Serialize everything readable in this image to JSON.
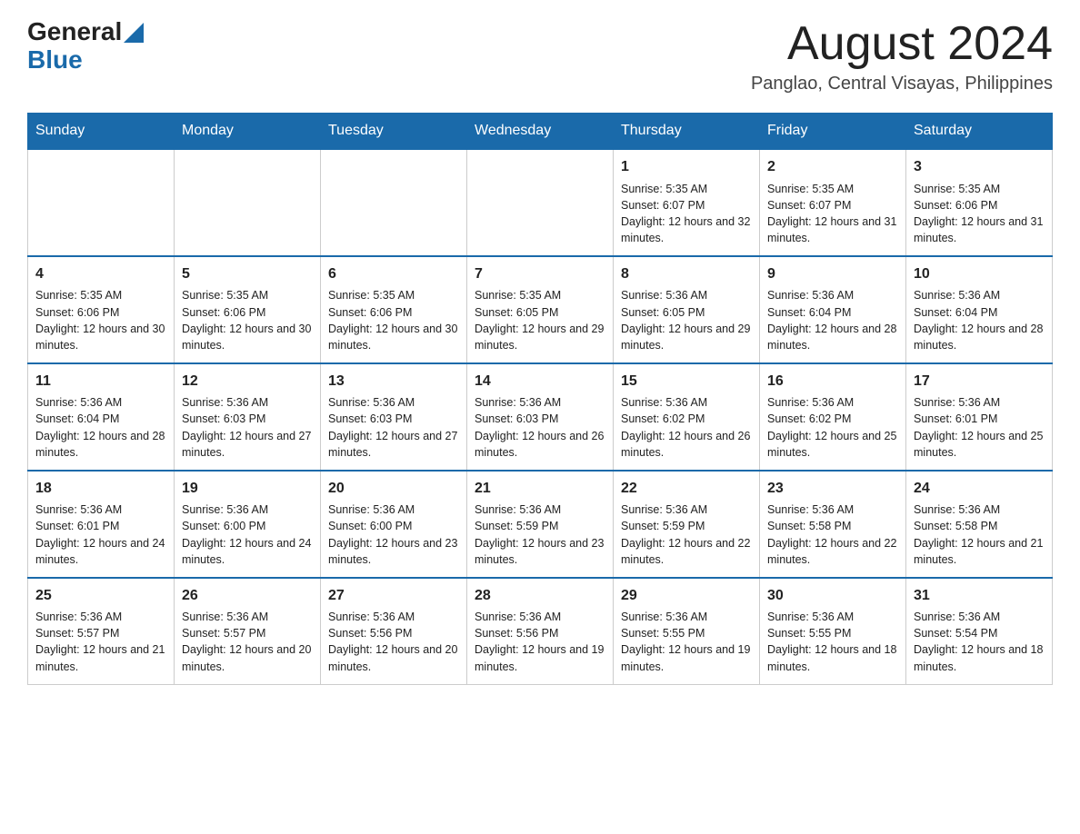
{
  "header": {
    "logo_general": "General",
    "logo_blue": "Blue",
    "month_title": "August 2024",
    "location": "Panglao, Central Visayas, Philippines"
  },
  "days_of_week": [
    "Sunday",
    "Monday",
    "Tuesday",
    "Wednesday",
    "Thursday",
    "Friday",
    "Saturday"
  ],
  "weeks": [
    [
      {
        "day": "",
        "info": ""
      },
      {
        "day": "",
        "info": ""
      },
      {
        "day": "",
        "info": ""
      },
      {
        "day": "",
        "info": ""
      },
      {
        "day": "1",
        "info": "Sunrise: 5:35 AM\nSunset: 6:07 PM\nDaylight: 12 hours and 32 minutes."
      },
      {
        "day": "2",
        "info": "Sunrise: 5:35 AM\nSunset: 6:07 PM\nDaylight: 12 hours and 31 minutes."
      },
      {
        "day": "3",
        "info": "Sunrise: 5:35 AM\nSunset: 6:06 PM\nDaylight: 12 hours and 31 minutes."
      }
    ],
    [
      {
        "day": "4",
        "info": "Sunrise: 5:35 AM\nSunset: 6:06 PM\nDaylight: 12 hours and 30 minutes."
      },
      {
        "day": "5",
        "info": "Sunrise: 5:35 AM\nSunset: 6:06 PM\nDaylight: 12 hours and 30 minutes."
      },
      {
        "day": "6",
        "info": "Sunrise: 5:35 AM\nSunset: 6:06 PM\nDaylight: 12 hours and 30 minutes."
      },
      {
        "day": "7",
        "info": "Sunrise: 5:35 AM\nSunset: 6:05 PM\nDaylight: 12 hours and 29 minutes."
      },
      {
        "day": "8",
        "info": "Sunrise: 5:36 AM\nSunset: 6:05 PM\nDaylight: 12 hours and 29 minutes."
      },
      {
        "day": "9",
        "info": "Sunrise: 5:36 AM\nSunset: 6:04 PM\nDaylight: 12 hours and 28 minutes."
      },
      {
        "day": "10",
        "info": "Sunrise: 5:36 AM\nSunset: 6:04 PM\nDaylight: 12 hours and 28 minutes."
      }
    ],
    [
      {
        "day": "11",
        "info": "Sunrise: 5:36 AM\nSunset: 6:04 PM\nDaylight: 12 hours and 28 minutes."
      },
      {
        "day": "12",
        "info": "Sunrise: 5:36 AM\nSunset: 6:03 PM\nDaylight: 12 hours and 27 minutes."
      },
      {
        "day": "13",
        "info": "Sunrise: 5:36 AM\nSunset: 6:03 PM\nDaylight: 12 hours and 27 minutes."
      },
      {
        "day": "14",
        "info": "Sunrise: 5:36 AM\nSunset: 6:03 PM\nDaylight: 12 hours and 26 minutes."
      },
      {
        "day": "15",
        "info": "Sunrise: 5:36 AM\nSunset: 6:02 PM\nDaylight: 12 hours and 26 minutes."
      },
      {
        "day": "16",
        "info": "Sunrise: 5:36 AM\nSunset: 6:02 PM\nDaylight: 12 hours and 25 minutes."
      },
      {
        "day": "17",
        "info": "Sunrise: 5:36 AM\nSunset: 6:01 PM\nDaylight: 12 hours and 25 minutes."
      }
    ],
    [
      {
        "day": "18",
        "info": "Sunrise: 5:36 AM\nSunset: 6:01 PM\nDaylight: 12 hours and 24 minutes."
      },
      {
        "day": "19",
        "info": "Sunrise: 5:36 AM\nSunset: 6:00 PM\nDaylight: 12 hours and 24 minutes."
      },
      {
        "day": "20",
        "info": "Sunrise: 5:36 AM\nSunset: 6:00 PM\nDaylight: 12 hours and 23 minutes."
      },
      {
        "day": "21",
        "info": "Sunrise: 5:36 AM\nSunset: 5:59 PM\nDaylight: 12 hours and 23 minutes."
      },
      {
        "day": "22",
        "info": "Sunrise: 5:36 AM\nSunset: 5:59 PM\nDaylight: 12 hours and 22 minutes."
      },
      {
        "day": "23",
        "info": "Sunrise: 5:36 AM\nSunset: 5:58 PM\nDaylight: 12 hours and 22 minutes."
      },
      {
        "day": "24",
        "info": "Sunrise: 5:36 AM\nSunset: 5:58 PM\nDaylight: 12 hours and 21 minutes."
      }
    ],
    [
      {
        "day": "25",
        "info": "Sunrise: 5:36 AM\nSunset: 5:57 PM\nDaylight: 12 hours and 21 minutes."
      },
      {
        "day": "26",
        "info": "Sunrise: 5:36 AM\nSunset: 5:57 PM\nDaylight: 12 hours and 20 minutes."
      },
      {
        "day": "27",
        "info": "Sunrise: 5:36 AM\nSunset: 5:56 PM\nDaylight: 12 hours and 20 minutes."
      },
      {
        "day": "28",
        "info": "Sunrise: 5:36 AM\nSunset: 5:56 PM\nDaylight: 12 hours and 19 minutes."
      },
      {
        "day": "29",
        "info": "Sunrise: 5:36 AM\nSunset: 5:55 PM\nDaylight: 12 hours and 19 minutes."
      },
      {
        "day": "30",
        "info": "Sunrise: 5:36 AM\nSunset: 5:55 PM\nDaylight: 12 hours and 18 minutes."
      },
      {
        "day": "31",
        "info": "Sunrise: 5:36 AM\nSunset: 5:54 PM\nDaylight: 12 hours and 18 minutes."
      }
    ]
  ]
}
